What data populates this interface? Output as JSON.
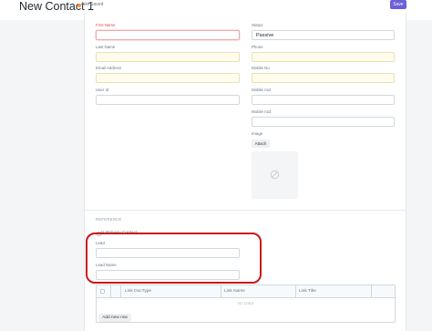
{
  "header": {
    "title": "New Contact 1",
    "status": "Not Saved",
    "save_label": "Save"
  },
  "left_fields": [
    {
      "label": "First Name",
      "value": "",
      "required": true
    },
    {
      "label": "Last Name",
      "value": ""
    },
    {
      "label": "Email Address",
      "value": ""
    },
    {
      "label": "User Id",
      "value": ""
    }
  ],
  "right_fields": [
    {
      "label": "Status",
      "value": "Passive"
    },
    {
      "label": "Phone",
      "value": ""
    },
    {
      "label": "Mobile No",
      "value": ""
    },
    {
      "label": "Mobile no2",
      "value": ""
    },
    {
      "label": "Mobile no3",
      "value": ""
    }
  ],
  "image": {
    "label": "Image",
    "attach_label": "Attach"
  },
  "reference": {
    "section_title": "REFERENCE",
    "primary_contact_label": "Is Primary Contact",
    "lead_label": "Lead",
    "lead_value": "",
    "lead_name_label": "Lead Name",
    "lead_name_value": ""
  },
  "links_table": {
    "columns": [
      "Link DocType",
      "Link Name",
      "Link Title"
    ],
    "empty_text": "No Data",
    "add_row_label": "Add new row"
  },
  "colors": {
    "accent": "#6b5ed8",
    "required": "#e24c4c",
    "unsaved_indicator": "#ff8c36",
    "highlight": "#c9171a"
  }
}
